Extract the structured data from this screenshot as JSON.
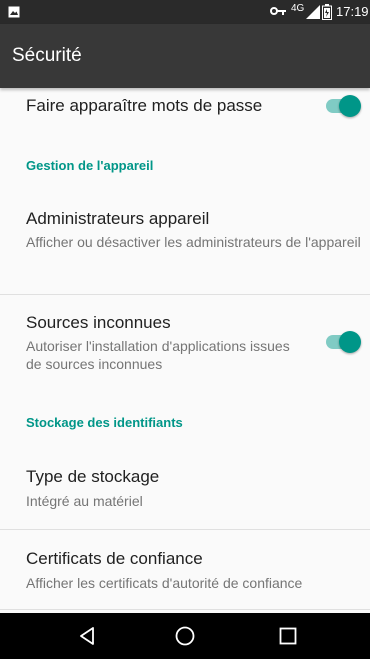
{
  "status_bar": {
    "network": "4G",
    "time": "17:19"
  },
  "app_bar": {
    "title": "Sécurité"
  },
  "settings": {
    "show_passwords": {
      "title": "Faire apparaître mots de passe",
      "enabled": true
    },
    "device_admin_header": "Gestion de l'appareil",
    "device_admins": {
      "title": "Administrateurs appareil",
      "summary": "Afficher ou désactiver les administrateurs de l'appareil"
    },
    "unknown_sources": {
      "title": "Sources inconnues",
      "summary": "Autoriser l'installation d'applications issues de sources inconnues",
      "enabled": true
    },
    "credential_storage_header": "Stockage des identifiants",
    "storage_type": {
      "title": "Type de stockage",
      "summary": "Intégré au matériel"
    },
    "trusted_certs": {
      "title": "Certificats de confiance",
      "summary": "Afficher les certificats d'autorité de confiance"
    }
  },
  "colors": {
    "accent": "#009688",
    "accent_track": "#80cbc4",
    "app_bar": "#383838",
    "status_bar": "#2a2a2a"
  },
  "icons": {
    "notification": "image-notification-icon",
    "vpn_key": "key-icon",
    "signal": "signal-icon",
    "battery": "battery-icon",
    "back": "back-triangle-icon",
    "home": "home-circle-icon",
    "recents": "recents-square-icon"
  }
}
